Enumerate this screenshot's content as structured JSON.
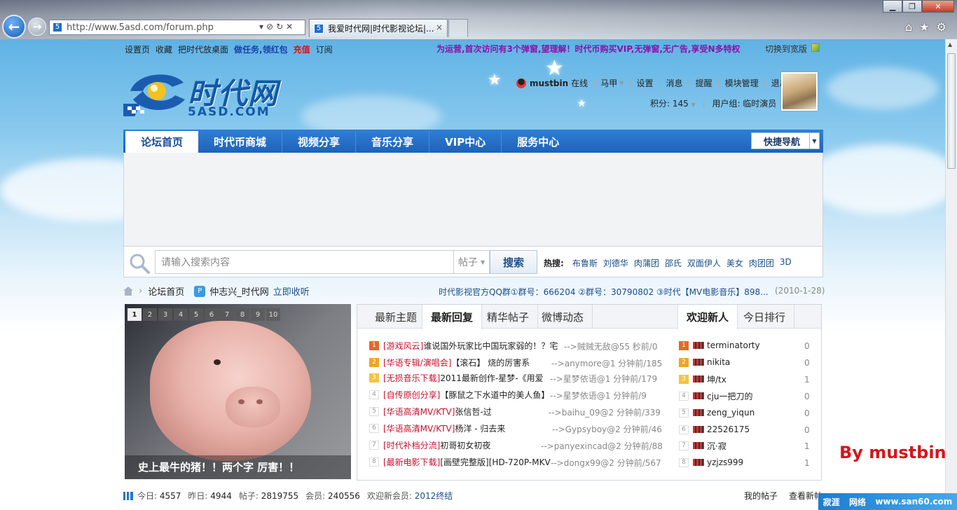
{
  "browser": {
    "url": "http://www.5asd.com/forum.php",
    "tab_title": "我爱时代网|时代影视论坛|...",
    "tab_close": "×",
    "back_glyph": "←",
    "forward_glyph": "→",
    "addr_controls": "▾⊘↻✕",
    "win_min": "▁",
    "win_max": "❐",
    "win_close": "✕",
    "home_glyph": "⌂",
    "fav_glyph": "★",
    "tools_glyph": "⚙"
  },
  "topbar": {
    "links": [
      "设置页",
      "收藏",
      "把时代放桌面"
    ],
    "task_link": "做任务,领红包",
    "recharge_link": "充值",
    "subscribe_link": "订阅",
    "notice": "为运营,首次访问有3个弹窗,望理解！时代币购买VIP,无弹窗,无广告,享受N多特权",
    "wide_switch": "切换到宽版"
  },
  "logo": {
    "title": "时代网",
    "sub": "5ASD.COM"
  },
  "user": {
    "name": "mustbin",
    "status": "在线",
    "horse": "马甲",
    "links": [
      "设置",
      "消息",
      "提醒",
      "模块管理",
      "退出"
    ],
    "points": "积分: 145",
    "group": "用户组: 临时演员"
  },
  "nav": {
    "items": [
      "论坛首页",
      "时代币商城",
      "视频分享",
      "音乐分享",
      "VIP中心",
      "服务中心"
    ],
    "quick": "快捷导航"
  },
  "search": {
    "placeholder": "请输入搜索内容",
    "type": "帖子",
    "button": "搜索",
    "hot_label": "热搜:",
    "hot": [
      "布鲁斯",
      "刘德华",
      "肉蒲团",
      "邵氏",
      "双面伊人",
      "美女",
      "肉团团",
      "3D"
    ]
  },
  "breadcrumb": {
    "home": "论坛首页",
    "radio": "仲志兴_时代网",
    "listen": "立即收听",
    "qq_notice": "时代影视官方QQ群①群号：666204 ②群号：30790802 ③时代【MV电影音乐】898...",
    "date": "(2010-1-28)"
  },
  "slideshow": {
    "numbers": [
      "1",
      "2",
      "3",
      "4",
      "5",
      "6",
      "7",
      "8",
      "9",
      "10"
    ],
    "caption": "史上最牛的猪！！两个字 厉害！！"
  },
  "tabs": {
    "left": [
      "最新主题",
      "最新回复",
      "精华帖子",
      "微博动态"
    ],
    "right": [
      "欢迎新人",
      "今日排行"
    ]
  },
  "threads": [
    {
      "n": "1",
      "cat": "[游戏风云]",
      "title": "谁说国外玩家比中国玩家弱的！？宅",
      "meta": "-->贼贼无敌@55 秒前/0"
    },
    {
      "n": "2",
      "cat": "[华语专辑/演唱会]",
      "title": "【滚石】 烧的厉害系",
      "meta": "-->anymore@1 分钟前/185"
    },
    {
      "n": "3",
      "cat": "[无损音乐下载]",
      "title": "2011最新创作-星梦-《用爱",
      "meta": "-->星梦依语@1 分钟前/179"
    },
    {
      "n": "4",
      "cat": "[自传原创分享]",
      "title": "【豚鼠之下水道中的美人鱼】",
      "meta": "-->星梦依语@1 分钟前/9"
    },
    {
      "n": "5",
      "cat": "[华语高清MV/KTV]",
      "title": "张信哲-过",
      "meta": "-->baihu_09@2 分钟前/339"
    },
    {
      "n": "6",
      "cat": "[华语高清MV/KTV]",
      "title": "杨洋 - 归去来",
      "meta": "-->Gypsyboy@2 分钟前/46"
    },
    {
      "n": "7",
      "cat": "[时代补档分流]",
      "title": "初哥初女初夜",
      "meta": "-->panyexincad@2 分钟前/88"
    },
    {
      "n": "8",
      "cat": "[最新电影下载]",
      "title": "[画壁完整版][HD-720P-MKV",
      "meta": "-->dongx99@2 分钟前/567"
    }
  ],
  "newbies": [
    {
      "n": "1",
      "name": "terminatorty",
      "count": "0"
    },
    {
      "n": "2",
      "name": "nikita",
      "count": "0"
    },
    {
      "n": "3",
      "name": "坤/tx",
      "count": "1"
    },
    {
      "n": "4",
      "name": "cju一把刀的",
      "count": "0"
    },
    {
      "n": "5",
      "name": "zeng_yiqun",
      "count": "0"
    },
    {
      "n": "6",
      "name": "22526175",
      "count": "0"
    },
    {
      "n": "7",
      "name": "沉·寂",
      "count": "1"
    },
    {
      "n": "8",
      "name": "yzjzs999",
      "count": "1"
    }
  ],
  "stats": {
    "today_label": "今日:",
    "today": "4557",
    "yesterday_label": "昨日:",
    "yesterday": "4944",
    "posts_label": "帖子:",
    "posts": "2819755",
    "members_label": "会员:",
    "members": "240556",
    "welcome_label": "欢迎新会员:",
    "welcome": "2012终结",
    "my_threads": "我的帖子",
    "new_posts": "查看新帖"
  },
  "watermark": {
    "by": "By mustbin",
    "wm1": "寂涯",
    "wm2": "网络",
    "wm3": "www.san60.com"
  }
}
